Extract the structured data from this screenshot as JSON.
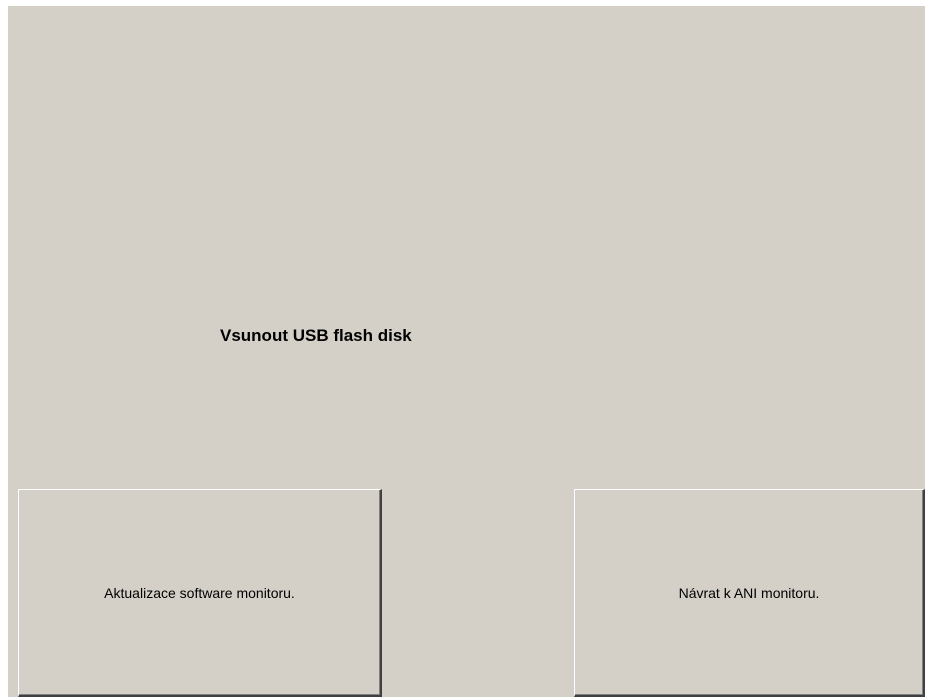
{
  "main": {
    "message": "Vsunout USB flash disk"
  },
  "buttons": {
    "update_label": "Aktualizace software monitoru.",
    "return_label": "Návrat k ANI monitoru."
  },
  "colors": {
    "background": "#d4d0c8",
    "text": "#000000"
  }
}
